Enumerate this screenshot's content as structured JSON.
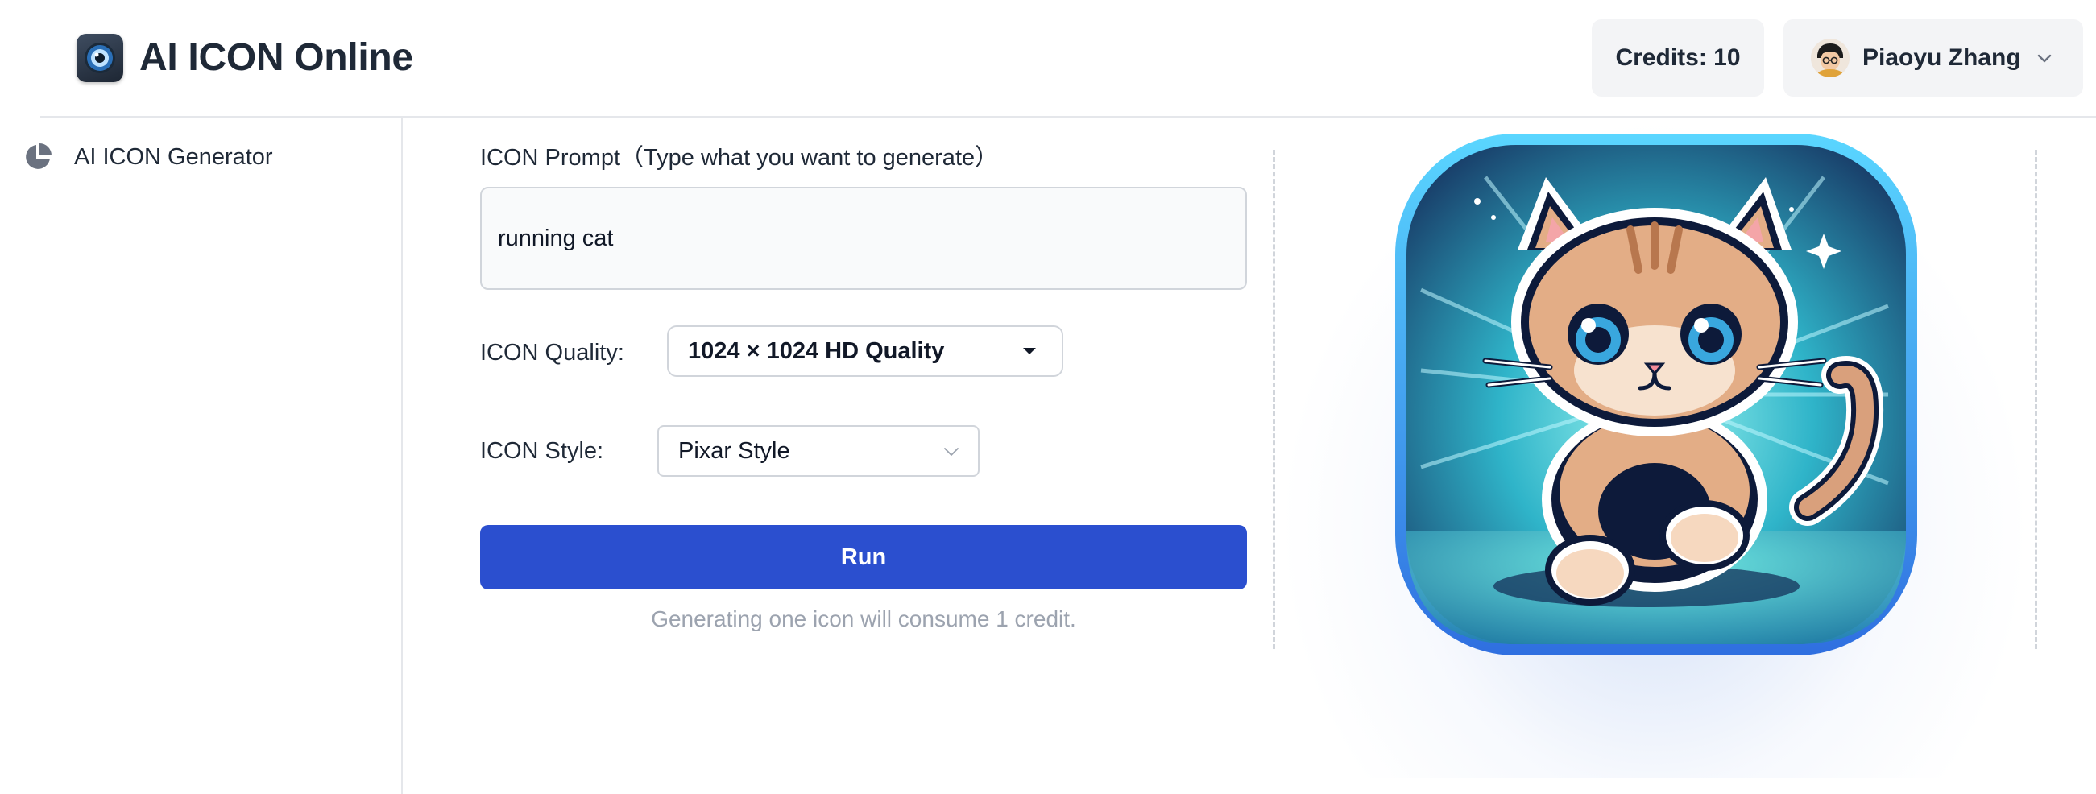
{
  "header": {
    "app_title": "AI ICON Online",
    "credits_label": "Credits: 10",
    "user_name": "Piaoyu Zhang"
  },
  "sidebar": {
    "items": [
      {
        "label": "AI ICON Generator",
        "icon": "pie-chart-icon"
      }
    ]
  },
  "form": {
    "prompt_label": "ICON Prompt（Type what you want to generate）",
    "prompt_value": "running cat",
    "quality_label": "ICON Quality:",
    "quality_value": "1024 × 1024 HD Quality",
    "style_label": "ICON Style:",
    "style_value": "Pixar Style",
    "run_label": "Run",
    "credit_note": "Generating one icon will consume 1 credit."
  },
  "result": {
    "image_subject": "running cat app icon"
  },
  "colors": {
    "accent": "#2b4fcf",
    "panel": "#f3f4f6",
    "muted_text": "#9ca3af"
  }
}
